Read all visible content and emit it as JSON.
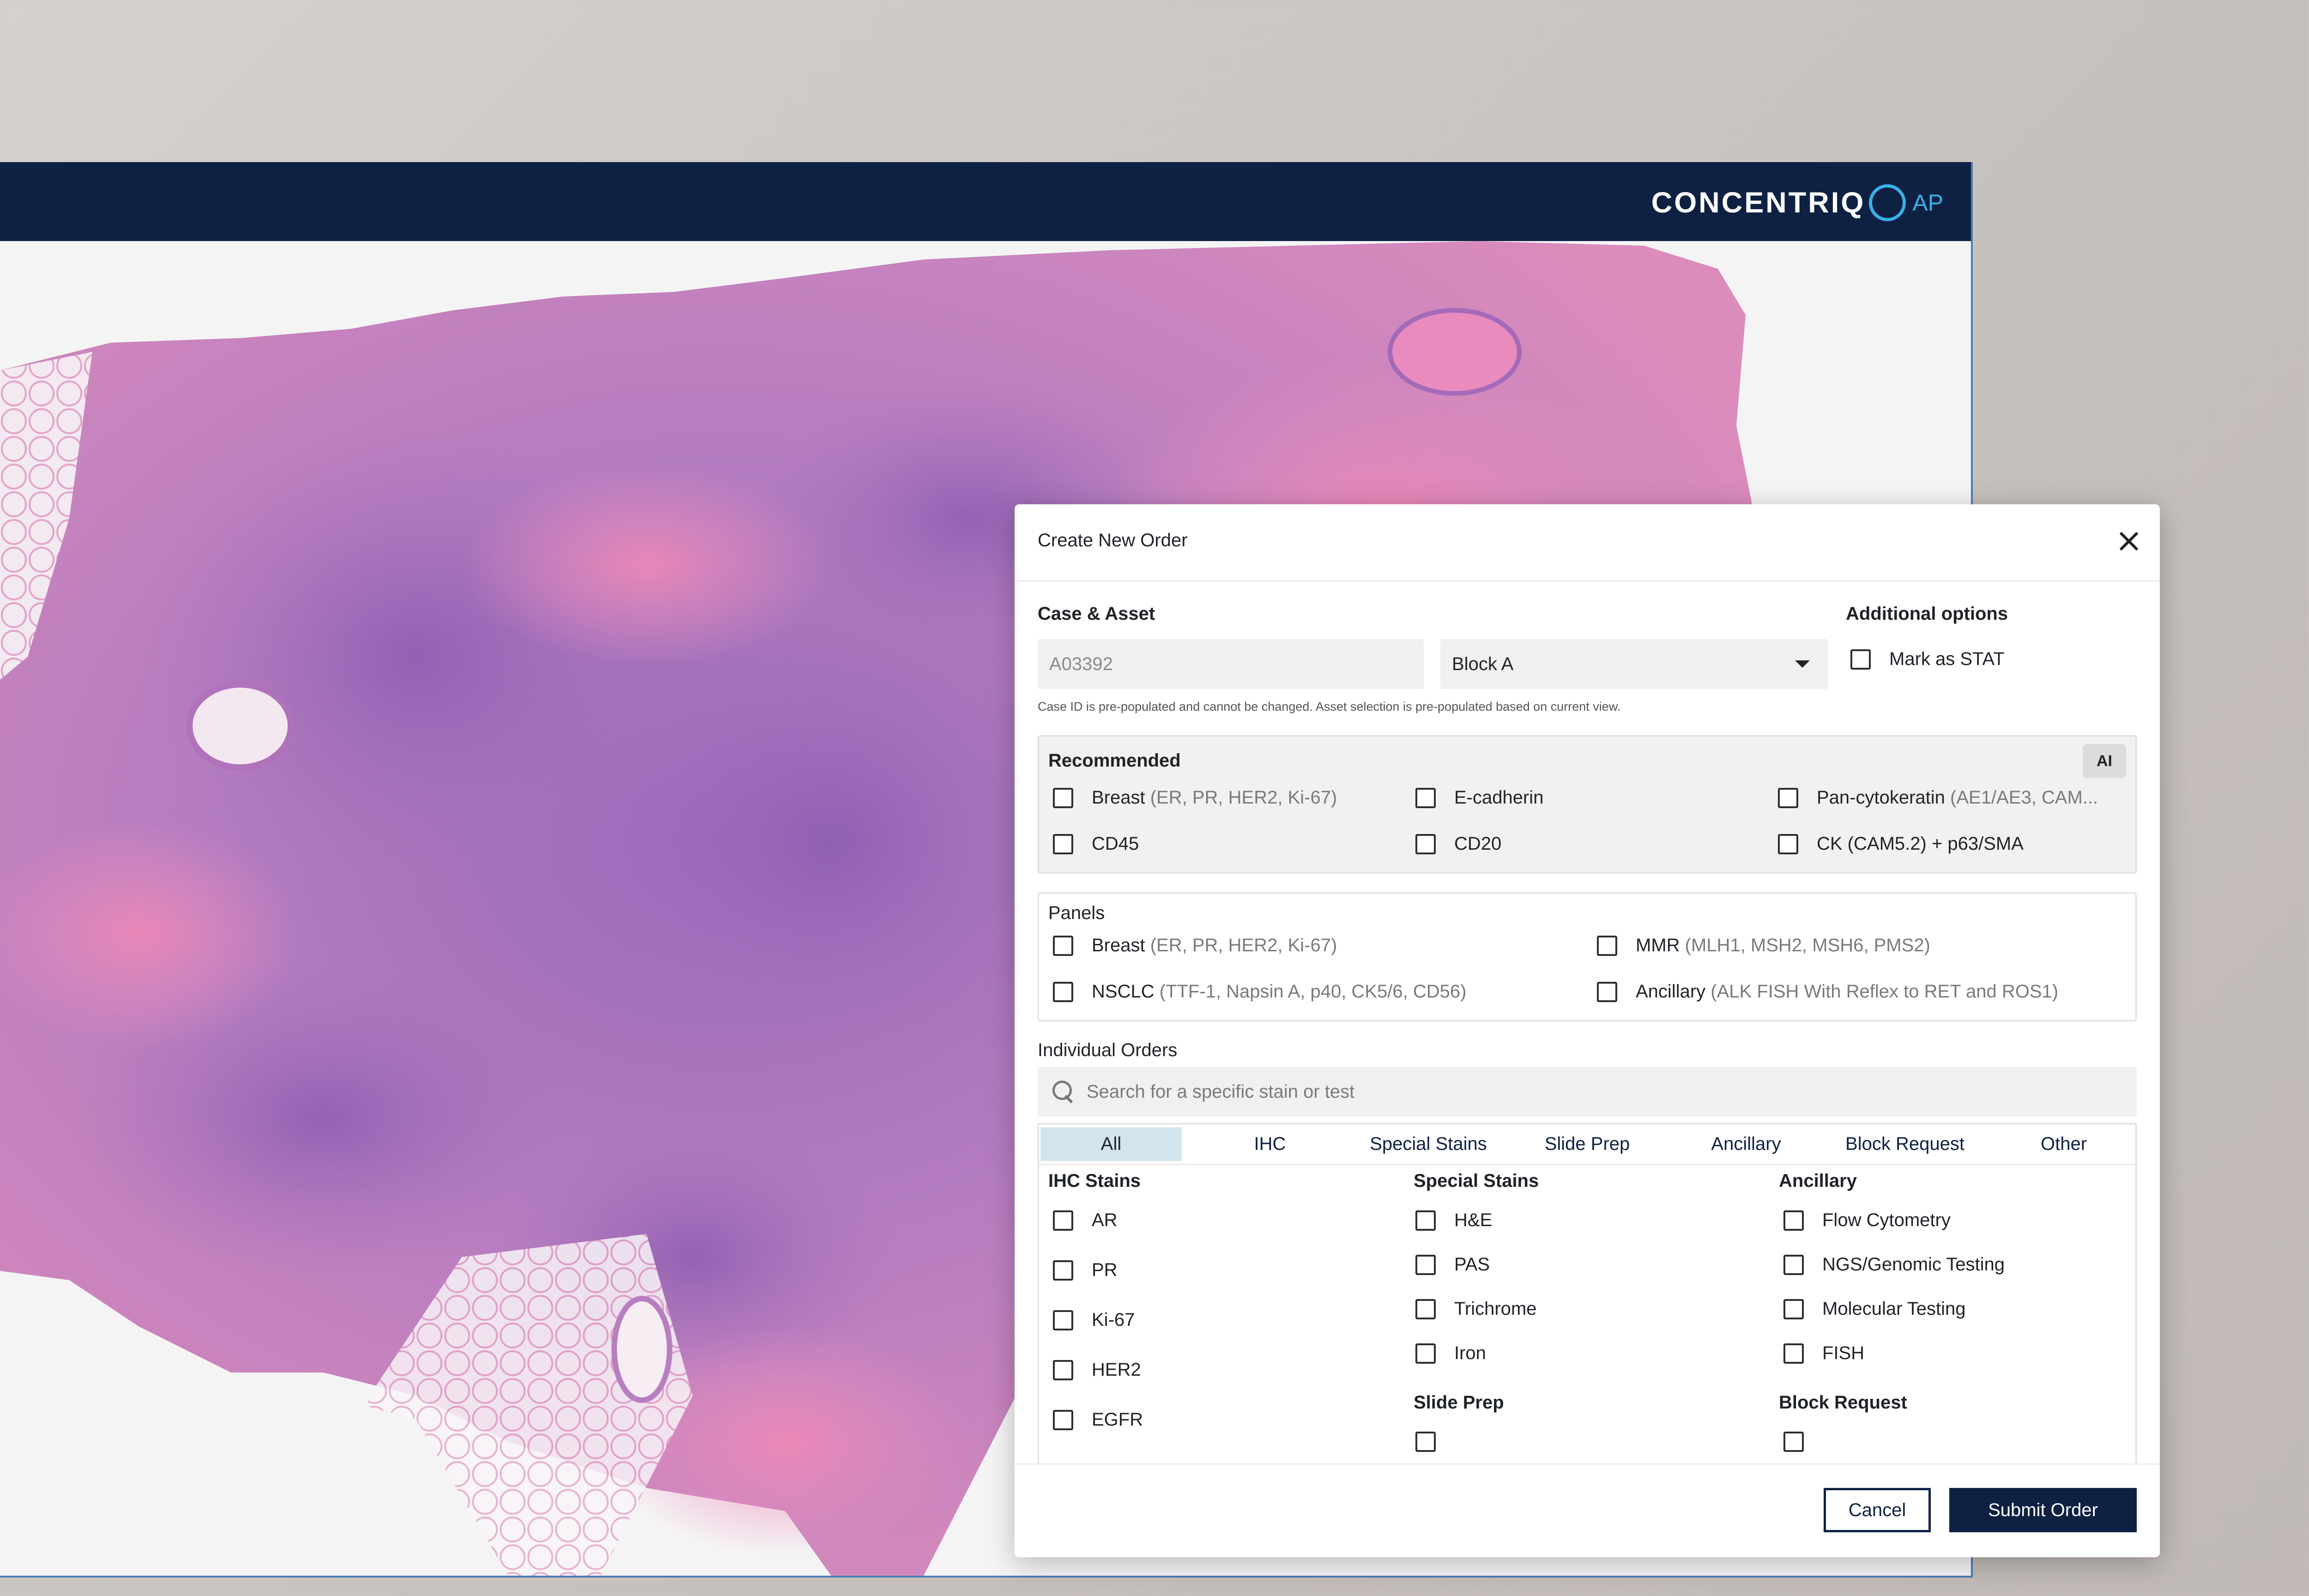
{
  "brand": {
    "name": "CONCENTRIQ",
    "suffix": "AP"
  },
  "modal": {
    "title": "Create New Order",
    "case_asset": {
      "label": "Case & Asset",
      "case_id": "A03392",
      "asset": "Block A",
      "helper": "Case ID is pre-populated and cannot be changed. Asset selection is pre-populated based on current view."
    },
    "additional": {
      "label": "Additional options",
      "stat": "Mark as STAT"
    },
    "recommended": {
      "label": "Recommended",
      "badge": "AI",
      "items": [
        {
          "name": "Breast",
          "detail": "(ER, PR, HER2, Ki-67)"
        },
        {
          "name": "E-cadherin",
          "detail": ""
        },
        {
          "name": "Pan-cytokeratin",
          "detail": "(AE1/AE3, CAM..."
        },
        {
          "name": "CD45",
          "detail": ""
        },
        {
          "name": "CD20",
          "detail": ""
        },
        {
          "name": "CK (CAM5.2) + p63/SMA",
          "detail": ""
        }
      ]
    },
    "panels": {
      "label": "Panels",
      "items": [
        {
          "name": "Breast",
          "detail": "(ER, PR, HER2, Ki-67)"
        },
        {
          "name": "MMR",
          "detail": "(MLH1, MSH2, MSH6, PMS2)"
        },
        {
          "name": "NSCLC",
          "detail": "(TTF-1, Napsin A, p40, CK5/6, CD56)"
        },
        {
          "name": "Ancillary",
          "detail": "(ALK FISH With Reflex to RET and ROS1)"
        }
      ]
    },
    "individual": {
      "label": "Individual Orders",
      "search_placeholder": "Search for a specific stain or test",
      "tabs": [
        "All",
        "IHC",
        "Special Stains",
        "Slide Prep",
        "Ancillary",
        "Block Request",
        "Other"
      ],
      "ihc": {
        "title": "IHC Stains",
        "items": [
          "AR",
          "PR",
          "Ki-67",
          "HER2",
          "EGFR"
        ]
      },
      "special": {
        "title": "Special Stains",
        "items": [
          "H&E",
          "PAS",
          "Trichrome",
          "Iron"
        ]
      },
      "slide_prep": {
        "title": "Slide Prep"
      },
      "ancillary": {
        "title": "Ancillary",
        "items": [
          "Flow Cytometry",
          "NGS/Genomic Testing",
          "Molecular Testing",
          "FISH"
        ]
      },
      "block_request": {
        "title": "Block Request"
      }
    },
    "footer": {
      "cancel": "Cancel",
      "submit": "Submit Order"
    }
  }
}
